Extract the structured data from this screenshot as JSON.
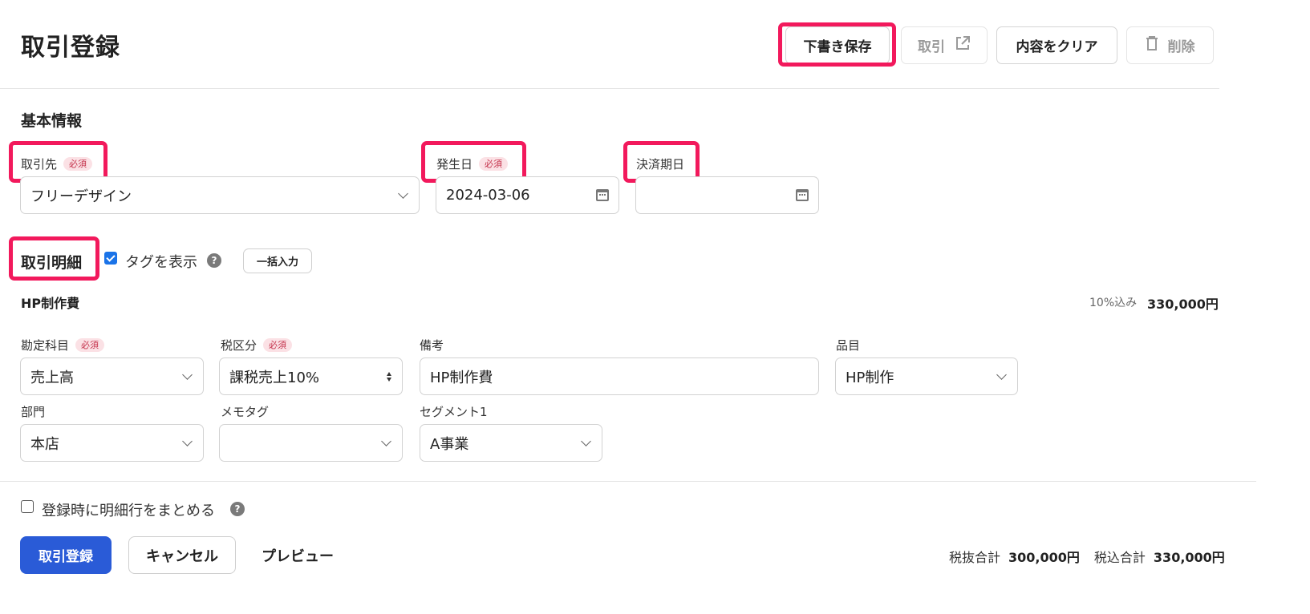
{
  "header": {
    "title": "取引登録",
    "draft_save": "下書き保存",
    "transaction": "取引",
    "clear": "内容をクリア",
    "delete": "削除"
  },
  "basic_info": {
    "section_title": "基本情報",
    "partner": {
      "label": "取引先",
      "required": "必須",
      "value": "フリーデザイン"
    },
    "issue_date": {
      "label": "発生日",
      "required": "必須",
      "value": "2024-03-06"
    },
    "due_date": {
      "label": "決済期日",
      "value": ""
    }
  },
  "details": {
    "section_title": "取引明細",
    "show_tags_label": "タグを表示",
    "show_tags_checked": true,
    "bulk_input": "一括入力",
    "row_title": "HP制作費",
    "tax_note": "10%込み",
    "row_amount": "330,000円",
    "account": {
      "label": "勘定科目",
      "required": "必須",
      "value": "売上高"
    },
    "tax_category": {
      "label": "税区分",
      "required": "必須",
      "value": "課税売上10%"
    },
    "memo": {
      "label": "備考",
      "value": "HP制作費"
    },
    "item": {
      "label": "品目",
      "value": "HP制作"
    },
    "department": {
      "label": "部門",
      "value": "本店"
    },
    "memo_tag": {
      "label": "メモタグ",
      "value": ""
    },
    "segment1": {
      "label": "セグメント1",
      "value": "A事業"
    }
  },
  "footer": {
    "merge_label": "登録時に明細行をまとめる",
    "merge_checked": false,
    "register": "取引登録",
    "cancel": "キャンセル",
    "preview": "プレビュー",
    "subtotal_label": "税抜合計",
    "subtotal_value": "300,000円",
    "total_label": "税込合計",
    "total_value": "330,000円"
  },
  "colors": {
    "highlight": "#f2195c",
    "primary": "#2a5bd7",
    "checkbox": "#1a73e8"
  }
}
